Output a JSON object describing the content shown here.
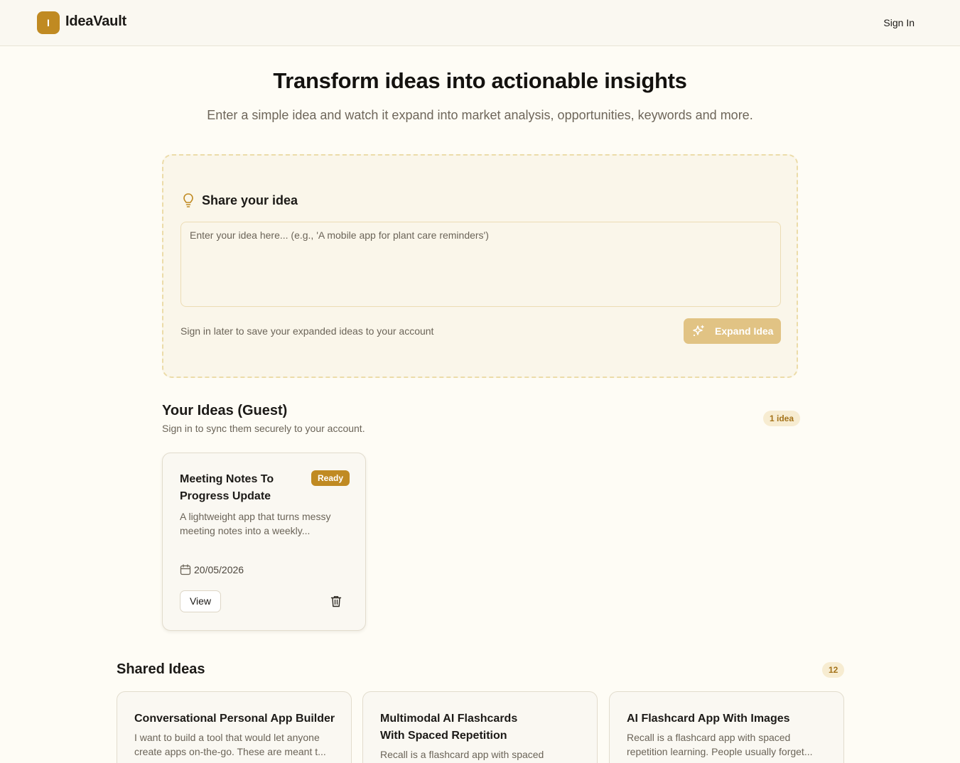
{
  "app": {
    "logo_letter": "I",
    "name": "IdeaVault"
  },
  "header": {
    "sign_in": "Sign In"
  },
  "hero": {
    "title": "Transform ideas into actionable insights",
    "subtitle": "Enter a simple idea and watch it expand into market analysis, opportunities, keywords and more."
  },
  "composer": {
    "title": "Share your idea",
    "placeholder": "Enter your idea here... (e.g., 'A mobile app for plant care reminders')",
    "hint": "Sign in later to save your expanded ideas to your account",
    "expand_label": "Expand Idea"
  },
  "your_ideas": {
    "title": "Your Ideas (Guest)",
    "subtitle": "Sign in to sync them securely to your account.",
    "count_label": "1 idea",
    "items": [
      {
        "title": "Meeting Notes To Progress Update",
        "status": "Ready",
        "description": "A lightweight app that turns messy meeting notes into a weekly...",
        "date": "20/05/2026",
        "view_label": "View"
      }
    ]
  },
  "shared_ideas": {
    "title": "Shared Ideas",
    "count": "12",
    "items": [
      {
        "title": "Conversational Personal App Builder",
        "description": "I want to build a tool that would let anyone create apps on-the-go. These are meant t..."
      },
      {
        "title": "Multimodal AI Flashcards With Spaced Repetition",
        "description": "Recall is a flashcard app with spaced"
      },
      {
        "title": "AI Flashcard App With Images",
        "description": "Recall is a flashcard app with spaced repetition learning. People usually forget..."
      }
    ]
  },
  "colors": {
    "accent": "#c08a22",
    "accent_muted": "#e1c384",
    "background": "#fefcf5",
    "badge_bg": "#f7ecd1"
  }
}
